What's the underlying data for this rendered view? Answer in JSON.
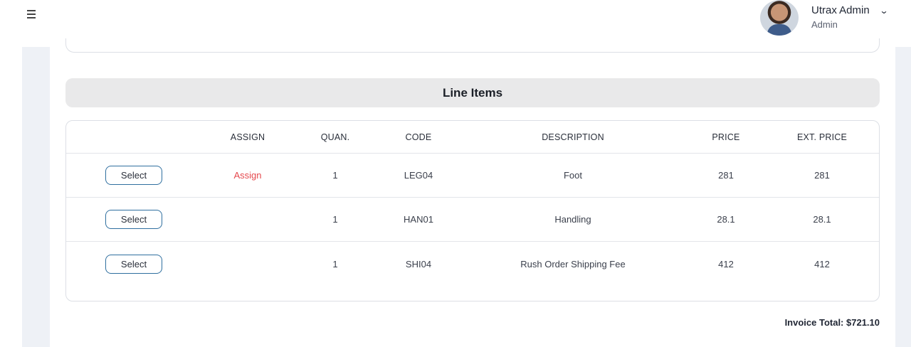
{
  "header": {
    "user_name": "Utrax Admin",
    "user_role": "Admin"
  },
  "line_items": {
    "title": "Line Items",
    "columns": {
      "select": "",
      "assign": "ASSIGN",
      "quan": "QUAN.",
      "code": "CODE",
      "description": "DESCRIPTION",
      "price": "PRICE",
      "ext_price": "EXT. PRICE"
    },
    "rows": [
      {
        "select_label": "Select",
        "assign": "Assign",
        "quan": "1",
        "code": "LEG04",
        "description": "Foot",
        "price": "281",
        "ext_price": "281"
      },
      {
        "select_label": "Select",
        "assign": "",
        "quan": "1",
        "code": "HAN01",
        "description": "Handling",
        "price": "28.1",
        "ext_price": "28.1"
      },
      {
        "select_label": "Select",
        "assign": "",
        "quan": "1",
        "code": "SHI04",
        "description": "Rush Order Shipping Fee",
        "price": "412",
        "ext_price": "412"
      }
    ]
  },
  "invoice_total": "Invoice Total: $721.10",
  "colors": {
    "assign_link": "#e5484d",
    "select_border": "#2f6f9f",
    "section_header_bg": "#e9e9ea"
  }
}
